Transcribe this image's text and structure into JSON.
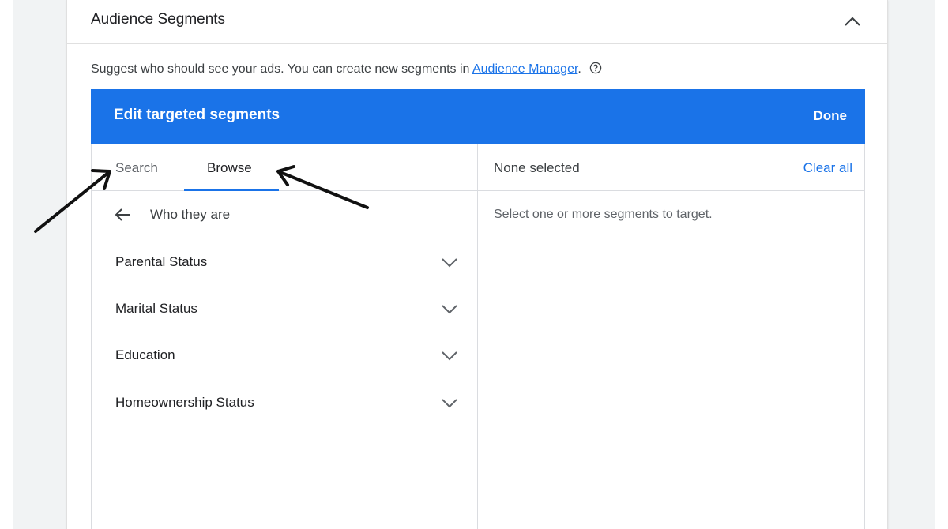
{
  "section": {
    "title": "Audience Segments",
    "description_prefix": "Suggest who should see your ads.  You can create new segments in ",
    "description_link": "Audience Manager",
    "description_suffix": "."
  },
  "editor": {
    "title": "Edit targeted segments",
    "done_label": "Done"
  },
  "left_panel": {
    "tabs": [
      {
        "label": "Search",
        "active": false
      },
      {
        "label": "Browse",
        "active": true
      }
    ],
    "back_label": "Who they are",
    "items": [
      {
        "label": "Parental Status"
      },
      {
        "label": "Marital Status"
      },
      {
        "label": "Education"
      },
      {
        "label": "Homeownership Status"
      }
    ]
  },
  "right_panel": {
    "status": "None selected",
    "clear_label": "Clear all",
    "hint": "Select one or more segments to target."
  },
  "colors": {
    "accent": "#1a73e8",
    "background": "#f1f3f4"
  }
}
